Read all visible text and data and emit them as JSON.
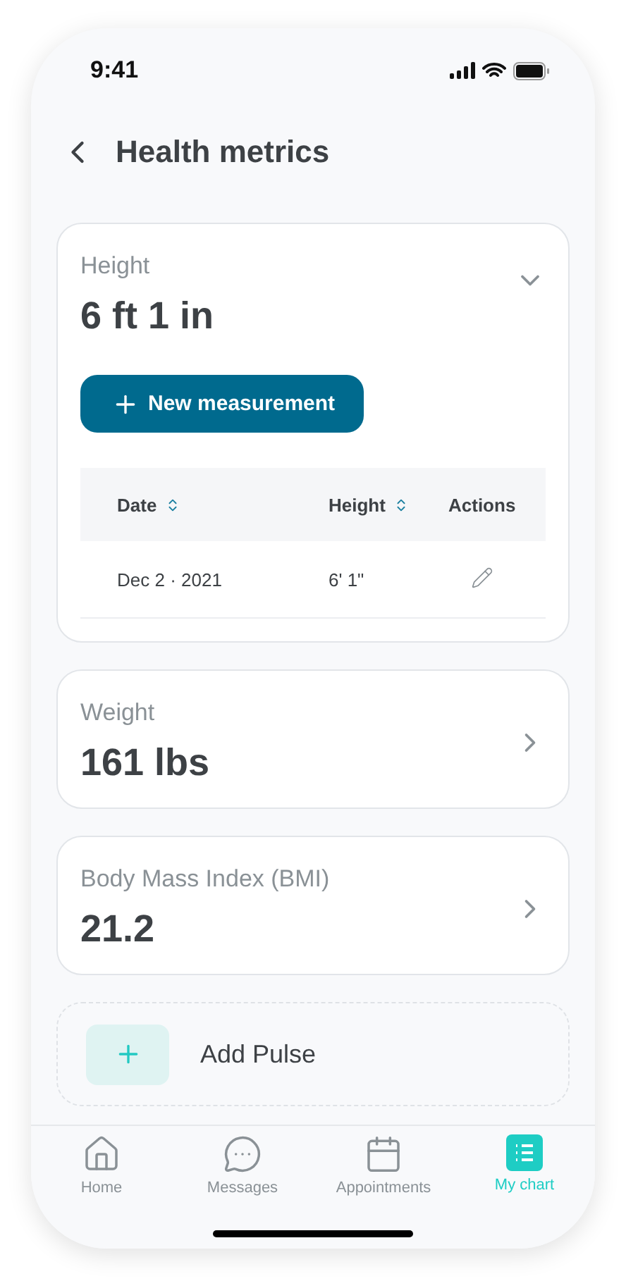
{
  "status_bar": {
    "time": "9:41"
  },
  "header": {
    "title": "Health metrics"
  },
  "metrics": [
    {
      "label": "Height",
      "value": "6 ft 1 in",
      "expanded": true,
      "action": "New measurement",
      "table": {
        "columns": [
          {
            "label": "Date",
            "sortable": true
          },
          {
            "label": "Height",
            "sortable": true
          },
          {
            "label": "Actions",
            "sortable": false
          }
        ],
        "rows": [
          {
            "date": "Dec 2 · 2021",
            "value": "6' 1\""
          }
        ]
      }
    },
    {
      "label": "Weight",
      "value": "161 lbs",
      "expanded": false
    },
    {
      "label": "Body Mass Index (BMI)",
      "value": "21.2",
      "expanded": false
    }
  ],
  "add_items": [
    "Add Pulse"
  ],
  "tabs": [
    {
      "label": "Home",
      "kind": "home",
      "selected": false
    },
    {
      "label": "Messages",
      "kind": "messages",
      "selected": false
    },
    {
      "label": "Appointments",
      "kind": "calendar",
      "selected": false
    },
    {
      "label": "My chart",
      "kind": "chart",
      "selected": true
    }
  ]
}
